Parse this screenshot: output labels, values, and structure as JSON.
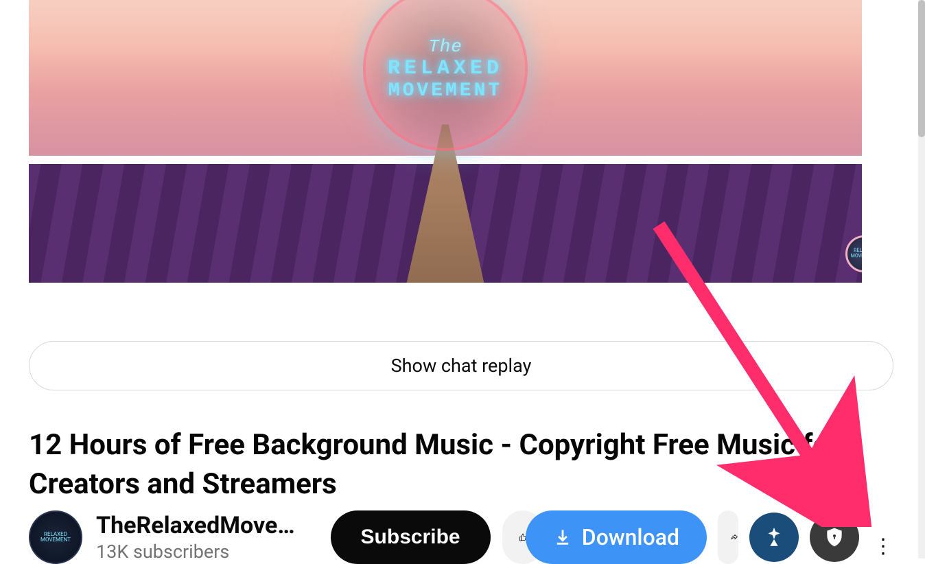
{
  "logo": {
    "the": "The",
    "line1": "RELAXED",
    "line2": "MOVEMENT",
    "mini_text": "RELAXED MOVEMENT"
  },
  "chat_replay": {
    "label": "Show chat replay"
  },
  "video": {
    "title": "12 Hours of Free Background Music - Copyright Free Music for Creators and Streamers"
  },
  "channel": {
    "name": "TheRelaxedMove…",
    "subscribers": "13K subscribers",
    "avatar_text": "RELAXED MOVEMENT"
  },
  "buttons": {
    "subscribe": "Subscribe",
    "download": "Download"
  }
}
